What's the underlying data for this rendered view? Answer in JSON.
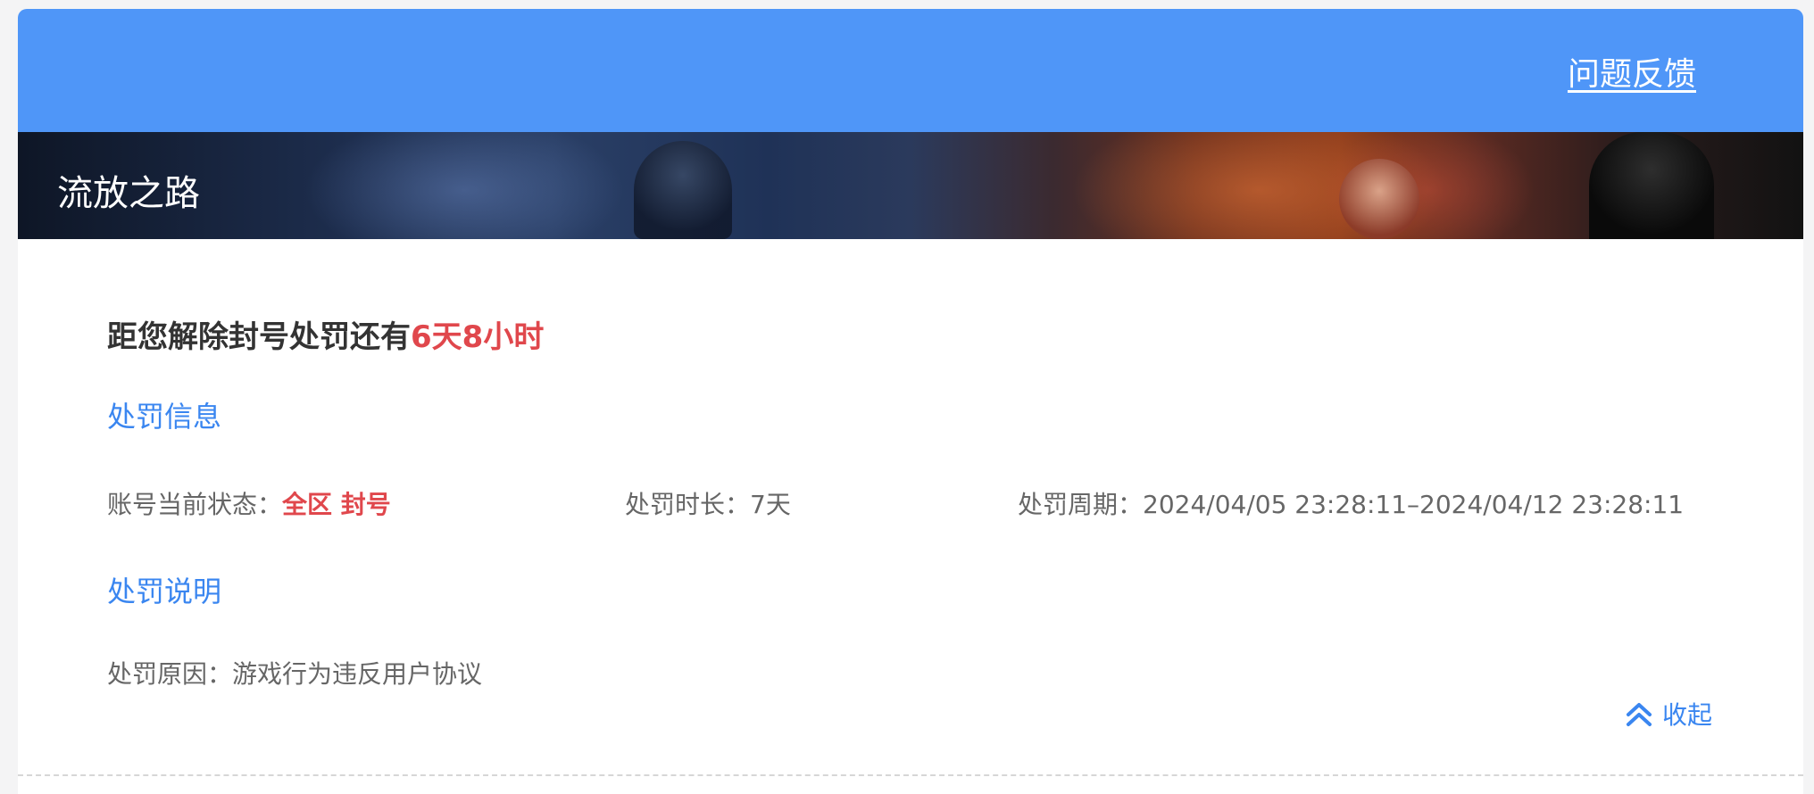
{
  "header": {
    "feedback_label": "问题反馈",
    "accent_color": "#4f96f8"
  },
  "banner": {
    "game_title": "流放之路"
  },
  "countdown": {
    "prefix": "距您解除封号处罚还有",
    "remaining": "6天8小时"
  },
  "penalty_info": {
    "title": "处罚信息",
    "status_label": "账号当前状态：",
    "status_value": "全区 封号",
    "duration_label": "处罚时长：",
    "duration_value": "7天",
    "period_label": "处罚周期：",
    "period_value": "2024/04/05 23:28:11–2024/04/12 23:28:11"
  },
  "penalty_explain": {
    "title": "处罚说明",
    "reason_label": "处罚原因：",
    "reason_value": "游戏行为违反用户协议"
  },
  "collapse": {
    "label": "收起",
    "icon": "double-chevron-up-icon"
  },
  "colors": {
    "highlight_red": "#e0474c",
    "link_blue": "#3a86f0"
  }
}
